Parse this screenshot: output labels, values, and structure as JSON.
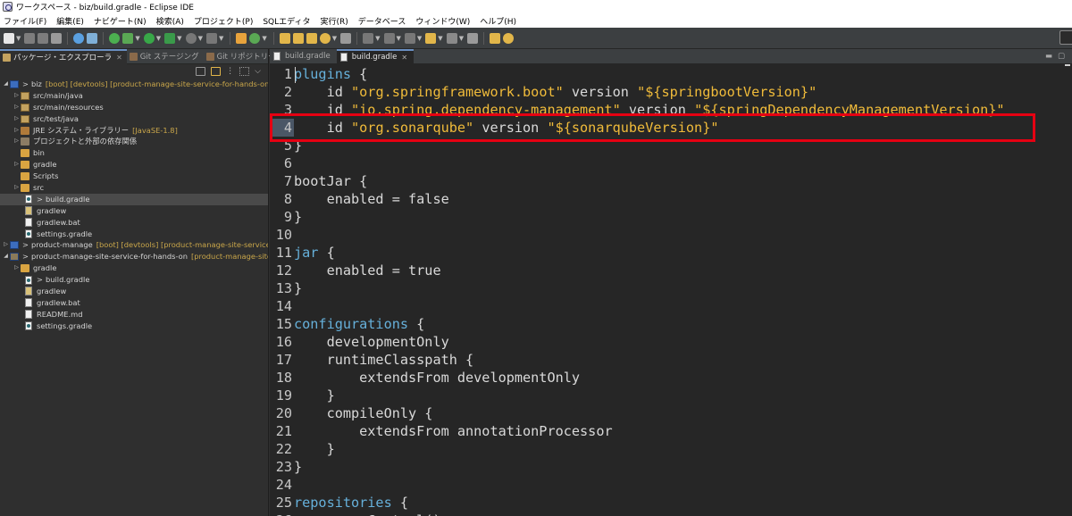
{
  "window": {
    "title": "ワークスペース - biz/build.gradle - Eclipse IDE"
  },
  "menu": [
    "ファイル(F)",
    "編集(E)",
    "ナビゲート(N)",
    "検索(A)",
    "プロジェクト(P)",
    "SQLエディタ",
    "実行(R)",
    "データベース",
    "ウィンドウ(W)",
    "ヘルプ(H)"
  ],
  "left_tabs": [
    {
      "label": "パッケージ・エクスプローラ"
    },
    {
      "label": "Git ステージング"
    },
    {
      "label": "Git リポジトリー"
    }
  ],
  "tree": [
    {
      "label": "biz",
      "deco": "[boot] [devtools] [product-manage-site-service-for-hands-on mas"
    },
    {
      "label": "src/main/java"
    },
    {
      "label": "src/main/resources"
    },
    {
      "label": "src/test/java"
    },
    {
      "label": "JRE システム・ライブラリー",
      "deco": "[JavaSE-1.8]"
    },
    {
      "label": "プロジェクトと外部の依存関係"
    },
    {
      "label": "bin"
    },
    {
      "label": "gradle"
    },
    {
      "label": "Scripts"
    },
    {
      "label": "src"
    },
    {
      "prefix": ">",
      "label": "build.gradle"
    },
    {
      "label": "gradlew"
    },
    {
      "label": "gradlew.bat"
    },
    {
      "label": "settings.gradle"
    },
    {
      "prefix": ">",
      "label": "product-manage",
      "deco": "[boot] [devtools] [product-manage-site-service-for-"
    },
    {
      "prefix": ">",
      "label": "product-manage-site-service-for-hands-on",
      "deco": "[product-manage-site-ser"
    },
    {
      "label": "gradle"
    },
    {
      "prefix": ">",
      "label": "build.gradle"
    },
    {
      "label": "gradlew"
    },
    {
      "label": "gradlew.bat"
    },
    {
      "label": "README.md"
    },
    {
      "label": "settings.gradle"
    }
  ],
  "editor_tabs": [
    {
      "label": "build.gradle"
    },
    {
      "label": "build.gradle"
    }
  ],
  "code_lines": [
    {
      "n": "1",
      "t": [
        [
          "kw",
          "plugins"
        ],
        [
          "c",
          " {"
        ]
      ]
    },
    {
      "n": "2",
      "t": [
        [
          "c",
          "    id "
        ],
        [
          "str",
          "\"org.springframework.boot\""
        ],
        [
          "c",
          " version "
        ],
        [
          "str",
          "\"${springbootVersion}\""
        ]
      ]
    },
    {
      "n": "3",
      "t": [
        [
          "c",
          "    id "
        ],
        [
          "str",
          "\"io.spring.dependency-management\""
        ],
        [
          "c",
          " version "
        ],
        [
          "str",
          "\"${springDependencyManagementVersion}\""
        ]
      ]
    },
    {
      "n": "4",
      "t": [
        [
          "c",
          "    id "
        ],
        [
          "str",
          "\"org.sonarqube\""
        ],
        [
          "c",
          " version "
        ],
        [
          "str",
          "\"${sonarqubeVersion}\""
        ]
      ]
    },
    {
      "n": "5",
      "t": [
        [
          "c",
          "}"
        ]
      ]
    },
    {
      "n": "6",
      "t": []
    },
    {
      "n": "7",
      "t": [
        [
          "c",
          "bootJar {"
        ]
      ]
    },
    {
      "n": "8",
      "t": [
        [
          "c",
          "    enabled = false"
        ]
      ]
    },
    {
      "n": "9",
      "t": [
        [
          "c",
          "}"
        ]
      ]
    },
    {
      "n": "10",
      "t": []
    },
    {
      "n": "11",
      "t": [
        [
          "kw",
          "jar"
        ],
        [
          "c",
          " {"
        ]
      ]
    },
    {
      "n": "12",
      "t": [
        [
          "c",
          "    enabled = true"
        ]
      ]
    },
    {
      "n": "13",
      "t": [
        [
          "c",
          "}"
        ]
      ]
    },
    {
      "n": "14",
      "t": []
    },
    {
      "n": "15",
      "t": [
        [
          "kw",
          "configurations"
        ],
        [
          "c",
          " {"
        ]
      ]
    },
    {
      "n": "16",
      "t": [
        [
          "c",
          "    developmentOnly"
        ]
      ]
    },
    {
      "n": "17",
      "t": [
        [
          "c",
          "    runtimeClasspath {"
        ]
      ]
    },
    {
      "n": "18",
      "t": [
        [
          "c",
          "        extendsFrom developmentOnly"
        ]
      ]
    },
    {
      "n": "19",
      "t": [
        [
          "c",
          "    }"
        ]
      ]
    },
    {
      "n": "20",
      "t": [
        [
          "c",
          "    compileOnly {"
        ]
      ]
    },
    {
      "n": "21",
      "t": [
        [
          "c",
          "        extendsFrom annotationProcessor"
        ]
      ]
    },
    {
      "n": "22",
      "t": [
        [
          "c",
          "    }"
        ]
      ]
    },
    {
      "n": "23",
      "t": [
        [
          "c",
          "}"
        ]
      ]
    },
    {
      "n": "24",
      "t": []
    },
    {
      "n": "25",
      "t": [
        [
          "kw",
          "repositories"
        ],
        [
          "c",
          " {"
        ]
      ]
    },
    {
      "n": "26",
      "t": [
        [
          "c",
          "    mavenCentral()"
        ]
      ]
    }
  ],
  "colors": {
    "keyword": "#66b0da",
    "string": "#f0bb3a",
    "highlight": "#e60012",
    "background": "#262626"
  }
}
